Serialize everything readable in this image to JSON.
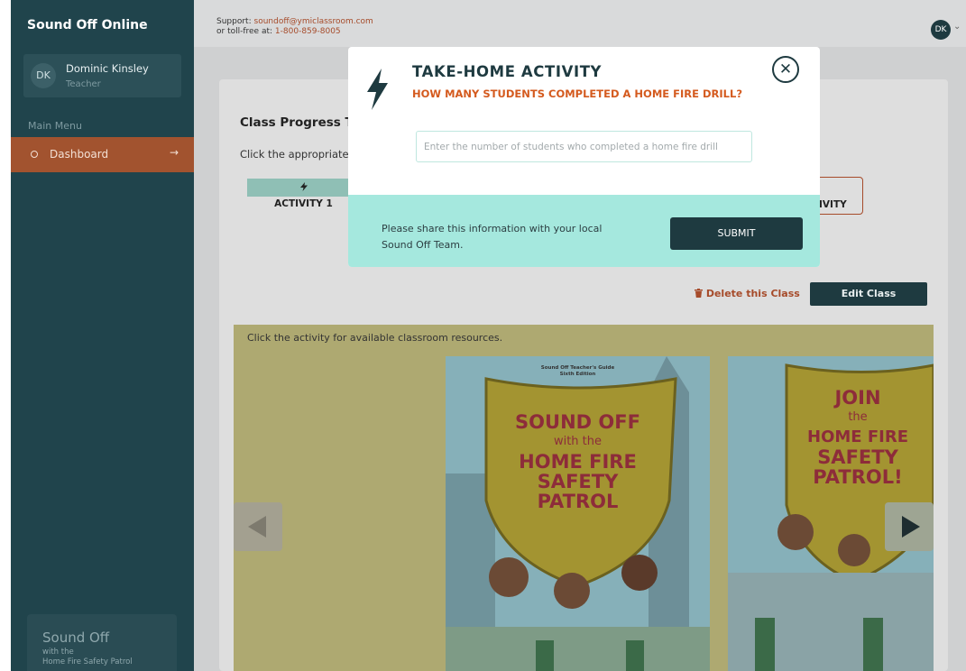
{
  "sidebar": {
    "brand": "Sound Off Online",
    "user": {
      "initials": "DK",
      "name": "Dominic Kinsley",
      "role": "Teacher"
    },
    "menu_title": "Main Menu",
    "items": [
      {
        "label": "Dashboard",
        "arrow": "→"
      }
    ],
    "footer": {
      "title": "Sound Off",
      "line1": "with the",
      "line2": "Home Fire Safety Patrol"
    }
  },
  "topbar": {
    "support_label": "Support:",
    "support_email": "soundoff@ymiclassroom.com",
    "tollfree_label": "or toll-free at:",
    "tollfree_number": "1-800-859-8005",
    "avatar_initials": "DK",
    "chevron": "⌄"
  },
  "main": {
    "title": "Class Progress Tra",
    "description": "Click the appropriate b",
    "activity1_label": "ACTIVITY 1",
    "activity_right_label": "IVITY",
    "delete_label": "Delete this Class",
    "edit_label": "Edit Class",
    "resources_text": "Click the activity for available classroom resources.",
    "covers": [
      {
        "guide_line1": "Sound Off Teacher's Guide",
        "guide_line2": "Sixth Edition",
        "lines": [
          "SOUND OFF",
          "with the",
          "HOME FIRE",
          "SAFETY",
          "PATROL"
        ]
      },
      {
        "lines": [
          "JOIN",
          "the",
          "HOME FIRE",
          "SAFETY",
          "PATROL!"
        ]
      }
    ]
  },
  "modal": {
    "title": "TAKE-HOME ACTIVITY",
    "subtitle": "HOW MANY STUDENTS COMPLETED A HOME FIRE DRILL?",
    "input_placeholder": "Enter the number of students who completed a home fire drill",
    "input_value": "",
    "footer_line1": "Please share this information with your local",
    "footer_line2": "Sound Off Team.",
    "submit_label": "SUBMIT",
    "close_glyph": "✕"
  },
  "colors": {
    "sidebar": "#20444c",
    "accent_orange": "#d45a1e",
    "dark_button": "#1e3a40",
    "modal_footer": "#a5e8de"
  },
  "icons": {
    "modal": "lightning-bolt-icon",
    "close": "close-circle-icon",
    "delete": "trash-icon",
    "menu": "circle-bullet-icon"
  }
}
